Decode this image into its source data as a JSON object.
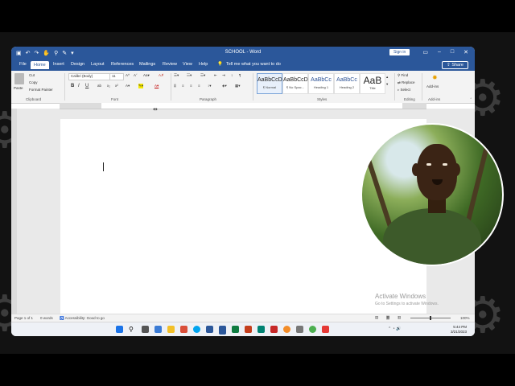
{
  "window": {
    "title": "SCHOOL - Word",
    "sign_in": "Sign in",
    "share": "Share",
    "qat_icons": [
      "save-icon",
      "undo-icon",
      "redo-icon",
      "touch-mode-icon",
      "search-icon",
      "draw-icon",
      "customize-icon"
    ]
  },
  "tabs": [
    "File",
    "Home",
    "Insert",
    "Design",
    "Layout",
    "References",
    "Mailings",
    "Review",
    "View",
    "Help"
  ],
  "tell_me": "Tell me what you want to do",
  "ribbon": {
    "clipboard": {
      "paste": "Paste",
      "cut": "Cut",
      "copy": "Copy",
      "format_painter": "Format Painter",
      "label": "Clipboard"
    },
    "font": {
      "name": "Calibri (Body)",
      "size": "11",
      "label": "Font",
      "bold": "B",
      "italic": "I",
      "underline": "U"
    },
    "paragraph": {
      "label": "Paragraph"
    },
    "styles": {
      "label": "Styles",
      "items": [
        {
          "preview": "AaBbCcDd",
          "name": "¶ Normal"
        },
        {
          "preview": "AaBbCcDd",
          "name": "¶ No Spac..."
        },
        {
          "preview": "AaBbCc",
          "name": "Heading 1"
        },
        {
          "preview": "AaBbCc",
          "name": "Heading 2"
        },
        {
          "preview": "AaB",
          "name": "Title"
        }
      ]
    },
    "editing": {
      "find": "Find",
      "replace": "Replace",
      "select": "Select",
      "label": "Editing"
    },
    "addins": {
      "button": "Add-ins",
      "label": "Add-ins"
    }
  },
  "status": {
    "page": "Page 1 of 1",
    "words": "0 words",
    "accessibility": "Accessibility: Good to go",
    "zoom": "100%"
  },
  "watermark": {
    "title": "Activate Windows",
    "subtitle": "Go to Settings to activate Windows."
  },
  "clock": {
    "time": "5:44 PM",
    "date": "3/21/2023"
  }
}
